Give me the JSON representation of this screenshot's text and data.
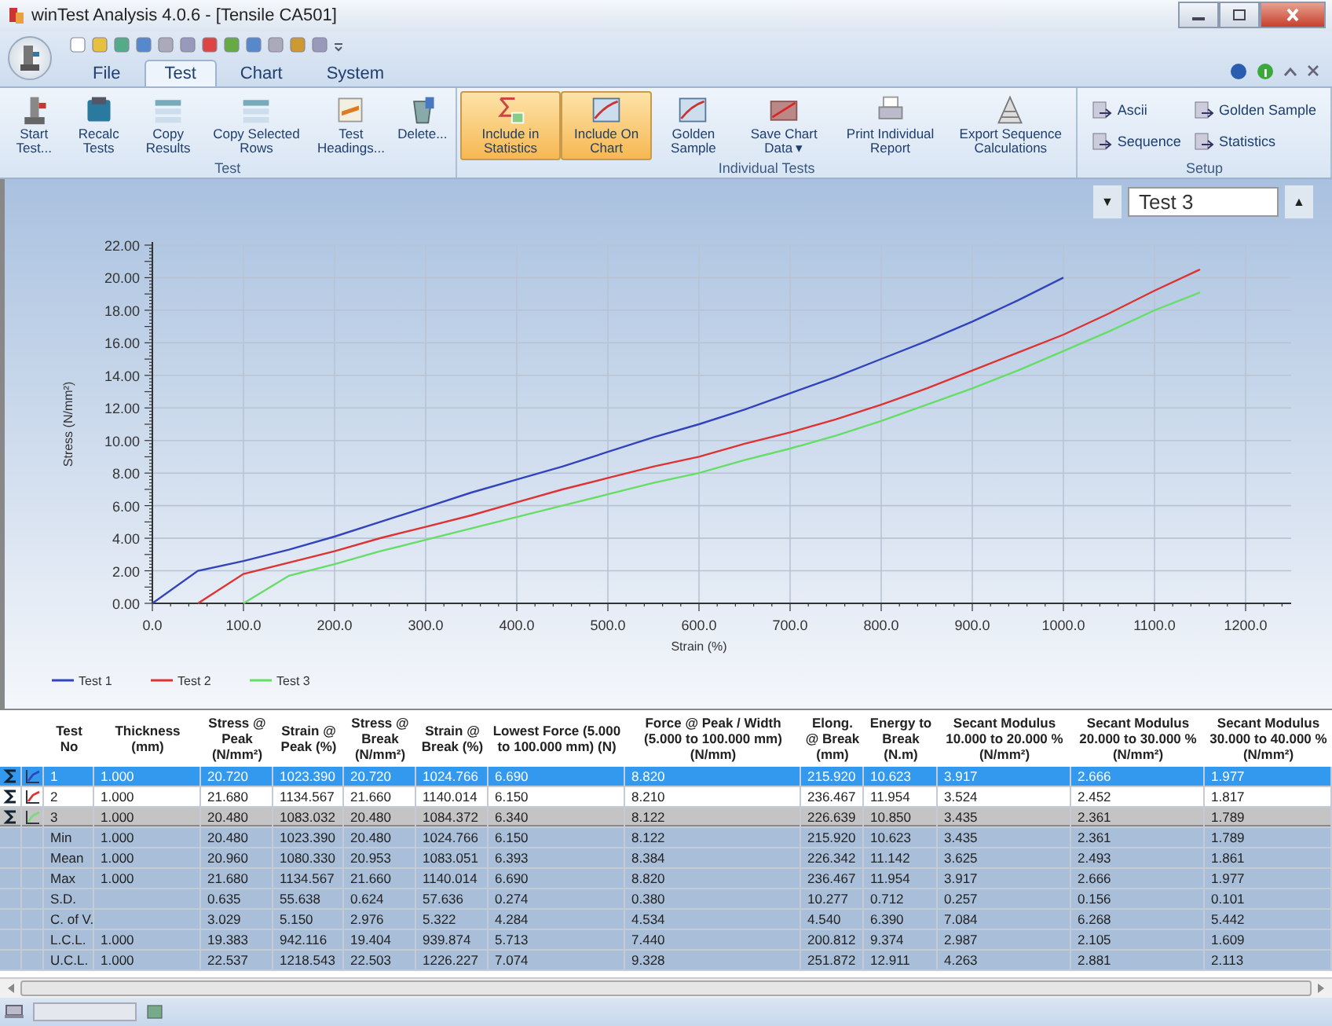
{
  "window": {
    "title": "winTest Analysis 4.0.6 - [Tensile CA501]"
  },
  "ribbon": {
    "tabs": [
      {
        "label": "File",
        "selected": false
      },
      {
        "label": "Test",
        "selected": true
      },
      {
        "label": "Chart",
        "selected": false
      },
      {
        "label": "System",
        "selected": false
      }
    ],
    "groups": [
      {
        "label": "Test",
        "kind": "large",
        "buttons": [
          {
            "label": "Start Test...",
            "on": false
          },
          {
            "label": "Recalc Tests",
            "on": false
          },
          {
            "label": "Copy Results",
            "on": false
          },
          {
            "label": "Copy Selected Rows",
            "on": false
          },
          {
            "label": "Test Headings...",
            "on": false
          },
          {
            "label": "Delete...",
            "on": false
          }
        ]
      },
      {
        "label": "Individual Tests",
        "kind": "large",
        "buttons": [
          {
            "label": "Include in Statistics",
            "on": true
          },
          {
            "label": "Include On Chart",
            "on": true
          },
          {
            "label": "Golden Sample",
            "on": false
          },
          {
            "label": "Save Chart Data",
            "on": false,
            "caret": "▾"
          },
          {
            "label": "Print Individual Report",
            "on": false
          },
          {
            "label": "Export Sequence Calculations",
            "on": false
          }
        ]
      },
      {
        "label": "Setup",
        "kind": "small",
        "buttons": [
          {
            "label": "Ascii",
            "on": false
          },
          {
            "label": "Golden Sample",
            "on": false
          },
          {
            "label": "Sequence",
            "on": false
          },
          {
            "label": "Statistics",
            "on": false
          }
        ]
      }
    ]
  },
  "chart": {
    "navigator": {
      "down": "▼",
      "value": "Test 3",
      "up": "▲"
    },
    "chart_data": {
      "type": "line",
      "grid": true,
      "legend": true,
      "xlabel": "Strain (%)",
      "ylabel": "Stress (N/mm²)",
      "x": [
        0,
        50,
        100,
        150,
        200,
        250,
        300,
        350,
        400,
        450,
        500,
        550,
        600,
        650,
        700,
        750,
        800,
        850,
        900,
        950,
        1000,
        1050,
        1100,
        1150
      ],
      "series": [
        {
          "name": "Test 1",
          "color": "#3344bb",
          "values": [
            0,
            2.0,
            2.6,
            3.3,
            4.1,
            5.0,
            5.9,
            6.8,
            7.6,
            8.4,
            9.3,
            10.2,
            11.0,
            11.9,
            12.9,
            13.9,
            15.0,
            16.1,
            17.3,
            18.6,
            20.0,
            null,
            null,
            null
          ]
        },
        {
          "name": "Test 2",
          "color": "#dd3333",
          "values": [
            null,
            0,
            1.8,
            2.5,
            3.2,
            4.0,
            4.7,
            5.4,
            6.2,
            7.0,
            7.7,
            8.4,
            9.0,
            9.8,
            10.5,
            11.3,
            12.2,
            13.2,
            14.3,
            15.4,
            16.5,
            17.8,
            19.2,
            20.5
          ]
        },
        {
          "name": "Test 3",
          "color": "#66dd66",
          "values": [
            null,
            null,
            0,
            1.7,
            2.4,
            3.2,
            3.9,
            4.6,
            5.3,
            6.0,
            6.7,
            7.4,
            8.0,
            8.8,
            9.5,
            10.3,
            11.2,
            12.2,
            13.2,
            14.3,
            15.5,
            16.7,
            18.0,
            19.1
          ]
        }
      ],
      "xlim": [
        0,
        1250
      ],
      "ylim": [
        0,
        22
      ],
      "xticks": [
        {
          "value": 0,
          "label": "0.0"
        },
        {
          "value": 100,
          "label": "100.0"
        },
        {
          "value": 200,
          "label": "200.0"
        },
        {
          "value": 300,
          "label": "300.0"
        },
        {
          "value": 400,
          "label": "400.0"
        },
        {
          "value": 500,
          "label": "500.0"
        },
        {
          "value": 600,
          "label": "600.0"
        },
        {
          "value": 700,
          "label": "700.0"
        },
        {
          "value": 800,
          "label": "800.0"
        },
        {
          "value": 900,
          "label": "900.0"
        },
        {
          "value": 1000,
          "label": "1000.0"
        },
        {
          "value": 1100,
          "label": "1100.0"
        },
        {
          "value": 1200,
          "label": "1200.0"
        }
      ],
      "yticks": [
        {
          "value": 0,
          "label": "0.00"
        },
        {
          "value": 2,
          "label": "2.00"
        },
        {
          "value": 4,
          "label": "4.00"
        },
        {
          "value": 6,
          "label": "6.00"
        },
        {
          "value": 8,
          "label": "8.00"
        },
        {
          "value": 10,
          "label": "10.00"
        },
        {
          "value": 12,
          "label": "12.00"
        },
        {
          "value": 14,
          "label": "14.00"
        },
        {
          "value": 16,
          "label": "16.00"
        },
        {
          "value": 18,
          "label": "18.00"
        },
        {
          "value": 20,
          "label": "20.00"
        },
        {
          "value": 22,
          "label": "22.00"
        }
      ]
    }
  },
  "table": {
    "columns": [
      "Test No",
      "Thickness (mm)",
      "Stress @ Peak (N/mm²)",
      "Strain @ Peak (%)",
      "Stress @ Break (N/mm²)",
      "Strain @ Break (%)",
      "Lowest Force (5.000 to 100.000 mm) (N)",
      "Force @ Peak / Width (5.000 to 100.000 mm) (N/mm)",
      "Elong. @ Break (mm)",
      "Energy to Break (N.m)",
      "Secant Modulus 10.000 to 20.000 % (N/mm²)",
      "Secant Modulus 20.000 to 30.000 % (N/mm²)",
      "Secant Modulus 30.000 to 40.000 % (N/mm²)"
    ],
    "rows": [
      {
        "kind": "test",
        "selected": true,
        "current": false,
        "color": "#3344bb",
        "cells": [
          "1",
          "1.000",
          "20.720",
          "1023.390",
          "20.720",
          "1024.766",
          "6.690",
          "8.820",
          "215.920",
          "10.623",
          "3.917",
          "2.666",
          "1.977"
        ]
      },
      {
        "kind": "test",
        "selected": false,
        "current": false,
        "color": "#dd3333",
        "cells": [
          "2",
          "1.000",
          "21.680",
          "1134.567",
          "21.660",
          "1140.014",
          "6.150",
          "8.210",
          "236.467",
          "11.954",
          "3.524",
          "2.452",
          "1.817"
        ]
      },
      {
        "kind": "test",
        "selected": false,
        "current": true,
        "color": "#77dd77",
        "cells": [
          "3",
          "1.000",
          "20.480",
          "1083.032",
          "20.480",
          "1084.372",
          "6.340",
          "8.122",
          "226.639",
          "10.850",
          "3.435",
          "2.361",
          "1.789"
        ]
      },
      {
        "kind": "statistic",
        "selected": false,
        "current": false,
        "cells": [
          "Min",
          "1.000",
          "20.480",
          "1023.390",
          "20.480",
          "1024.766",
          "6.150",
          "8.122",
          "215.920",
          "10.623",
          "3.435",
          "2.361",
          "1.789"
        ]
      },
      {
        "kind": "statistic",
        "selected": false,
        "current": false,
        "cells": [
          "Mean",
          "1.000",
          "20.960",
          "1080.330",
          "20.953",
          "1083.051",
          "6.393",
          "8.384",
          "226.342",
          "11.142",
          "3.625",
          "2.493",
          "1.861"
        ]
      },
      {
        "kind": "statistic",
        "selected": false,
        "current": false,
        "cells": [
          "Max",
          "1.000",
          "21.680",
          "1134.567",
          "21.660",
          "1140.014",
          "6.690",
          "8.820",
          "236.467",
          "11.954",
          "3.917",
          "2.666",
          "1.977"
        ]
      },
      {
        "kind": "statistic",
        "selected": false,
        "current": false,
        "cells": [
          "S.D.",
          null,
          "0.635",
          "55.638",
          "0.624",
          "57.636",
          "0.274",
          "0.380",
          "10.277",
          "0.712",
          "0.257",
          "0.156",
          "0.101"
        ]
      },
      {
        "kind": "statistic",
        "selected": false,
        "current": false,
        "cells": [
          "C. of V.",
          null,
          "3.029",
          "5.150",
          "2.976",
          "5.322",
          "4.284",
          "4.534",
          "4.540",
          "6.390",
          "7.084",
          "6.268",
          "5.442"
        ]
      },
      {
        "kind": "statistic",
        "selected": false,
        "current": false,
        "cells": [
          "L.C.L.",
          "1.000",
          "19.383",
          "942.116",
          "19.404",
          "939.874",
          "5.713",
          "7.440",
          "200.812",
          "9.374",
          "2.987",
          "2.105",
          "1.609"
        ]
      },
      {
        "kind": "statistic",
        "selected": false,
        "current": false,
        "cells": [
          "U.C.L.",
          "1.000",
          "22.537",
          "1218.543",
          "22.503",
          "1226.227",
          "7.074",
          "9.328",
          "251.872",
          "12.911",
          "4.263",
          "2.881",
          "2.113"
        ]
      }
    ]
  }
}
